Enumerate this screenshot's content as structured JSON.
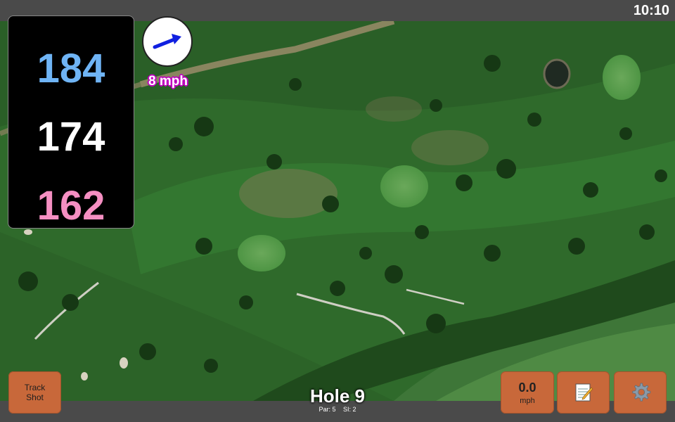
{
  "status": {
    "time": "10:10"
  },
  "yardage": {
    "back": "184",
    "middle": "174",
    "front": "162"
  },
  "wind": {
    "speed_label": "8 mph",
    "direction_icon": "arrow-right-up-icon",
    "arrow_color": "#1020e0"
  },
  "controls": {
    "track_shot_line1": "Track",
    "track_shot_line2": "Shot",
    "speed_value": "0.0",
    "speed_unit": "mph",
    "notes_icon": "notepad-icon",
    "settings_icon": "gear-icon"
  },
  "hole": {
    "title": "Hole 9",
    "par": "Par: 5",
    "si": "SI: 2"
  },
  "colors": {
    "button_orange": "#c8683a",
    "back_yardage": "#6fb4f5",
    "middle_yardage": "#ffffff",
    "front_yardage": "#f58fc2",
    "wind_label_outline": "#c000c0"
  }
}
